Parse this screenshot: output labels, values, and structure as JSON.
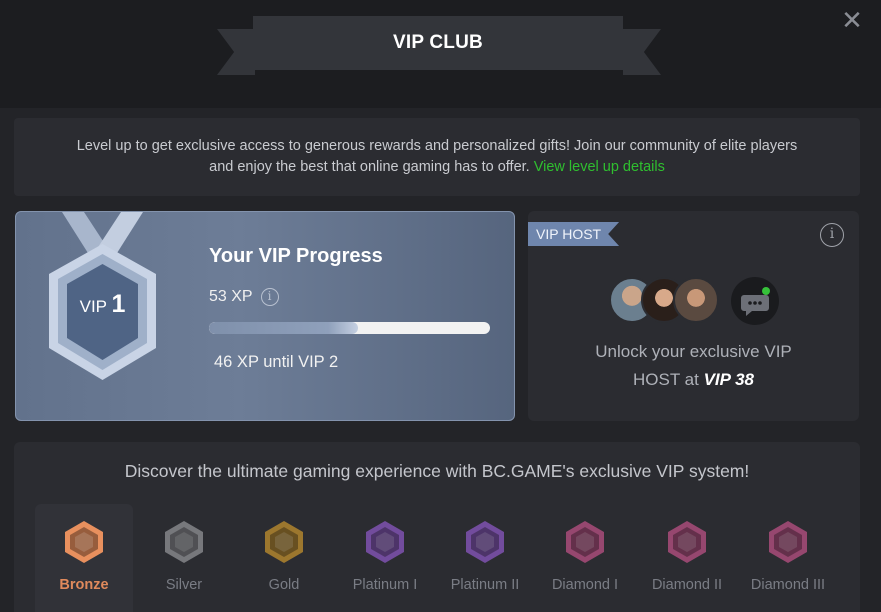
{
  "header": {
    "title": "VIP CLUB",
    "close_icon": "close-icon"
  },
  "intro": {
    "text": "Level up to get exclusive access to generous rewards and personalized gifts! Join our community of elite players and enjoy the best that online gaming has to offer.",
    "link": "View level up details",
    "link_color": "#2fbf2f"
  },
  "progress": {
    "title": "Your VIP Progress",
    "level_prefix": "VIP",
    "level": "1",
    "xp": "53 XP",
    "progress_fraction": 0.53,
    "until_next": "46 XP until VIP 2"
  },
  "host": {
    "tag": "VIP HOST",
    "text_line1": "Unlock your exclusive VIP",
    "text_line2_prefix": "HOST at",
    "text_line2_level": "VIP 38"
  },
  "system": {
    "title": "Discover the ultimate gaming experience with BC.GAME's exclusive VIP system!",
    "tiers": [
      {
        "label": "Bronze",
        "color": "#e8905e",
        "active": true
      },
      {
        "label": "Silver",
        "color": "#8a8b8f",
        "active": false
      },
      {
        "label": "Gold",
        "color": "#b98a2e",
        "active": false
      },
      {
        "label": "Platinum I",
        "color": "#8455b8",
        "active": false
      },
      {
        "label": "Platinum II",
        "color": "#8455b8",
        "active": false
      },
      {
        "label": "Diamond I",
        "color": "#b14e7f",
        "active": false
      },
      {
        "label": "Diamond II",
        "color": "#b14e7f",
        "active": false
      },
      {
        "label": "Diamond III",
        "color": "#b14e7f",
        "active": false
      }
    ]
  }
}
